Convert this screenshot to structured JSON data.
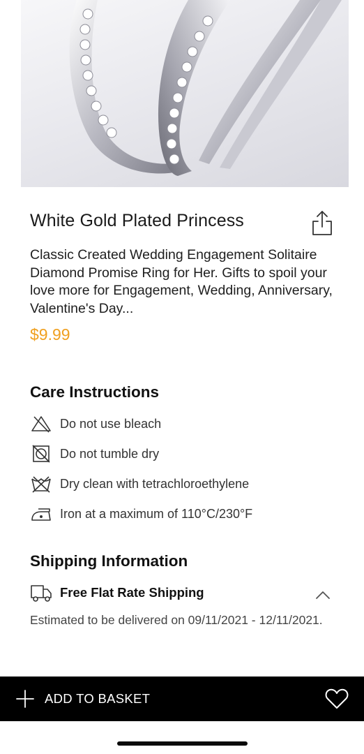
{
  "product": {
    "title": "White Gold Plated Princess",
    "description": "Classic Created Wedding Engagement Solitaire Diamond Promise Ring for Her. Gifts to spoil your love more for Engagement, Wedding, Anniversary, Valentine's Day...",
    "price": "$9.99",
    "price_color": "#f0a020",
    "image_icon": "ring-photo",
    "share_icon": "share-icon"
  },
  "care": {
    "title": "Care Instructions",
    "items": [
      {
        "icon": "no-bleach-icon",
        "label": "Do not use bleach"
      },
      {
        "icon": "no-tumble-dry-icon",
        "label": "Do not tumble dry"
      },
      {
        "icon": "dry-clean-icon",
        "label": "Dry clean with tetrachloroethylene"
      },
      {
        "icon": "iron-icon",
        "label": "Iron at a maximum of 110°C/230°F"
      }
    ]
  },
  "shipping": {
    "title": "Shipping Information",
    "method": "Free Flat Rate Shipping",
    "method_icon": "truck-icon",
    "toggle_icon": "chevron-up-icon",
    "estimate": "Estimated to be delivered on 09/11/2021 - 12/11/2021."
  },
  "bottom_bar": {
    "add_label": "ADD TO BASKET",
    "add_icon": "plus-icon",
    "favorite_icon": "heart-icon",
    "background": "#000000"
  }
}
